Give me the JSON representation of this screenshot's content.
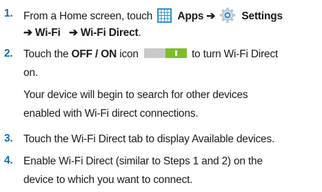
{
  "steps": [
    {
      "number": "1.",
      "line1_prefix": "From a Home screen, touch",
      "apps_icon": "apps-grid-icon",
      "apps_label": "Apps",
      "arrow": "➔",
      "settings_icon": "settings-gear-icon",
      "settings_label": "Settings",
      "wifi_label": "Wi-Fi",
      "wifi_direct_label": "Wi-Fi Direct",
      "period": "."
    },
    {
      "number": "2.",
      "line1_prefix": "Touch the",
      "toggle_label": "OFF / ON",
      "line1_mid": "icon",
      "toggle_icon": "on-off-toggle-icon",
      "toggle_state": "on",
      "line1_suffix": "to turn Wi-Fi Direct",
      "line2": "on.",
      "note_line1": "Your device will begin to search for other devices",
      "note_line2": "enabled with Wi-Fi direct connections."
    },
    {
      "number": "3.",
      "text": "Touch the Wi-Fi Direct tab to display Available devices."
    },
    {
      "number": "4.",
      "line1": "Enable Wi-Fi Direct (similar to Steps 1 and 2) on the",
      "line2": "device to which you want to connect."
    }
  ],
  "colors": {
    "step_number": "#0f6fa8",
    "text": "#1a1a1a",
    "apps_icon": "#2a8fd0",
    "settings_icon": "#3a9ad9",
    "toggle_track": "#c9c9c9",
    "toggle_knob": "#7bbf2a"
  }
}
